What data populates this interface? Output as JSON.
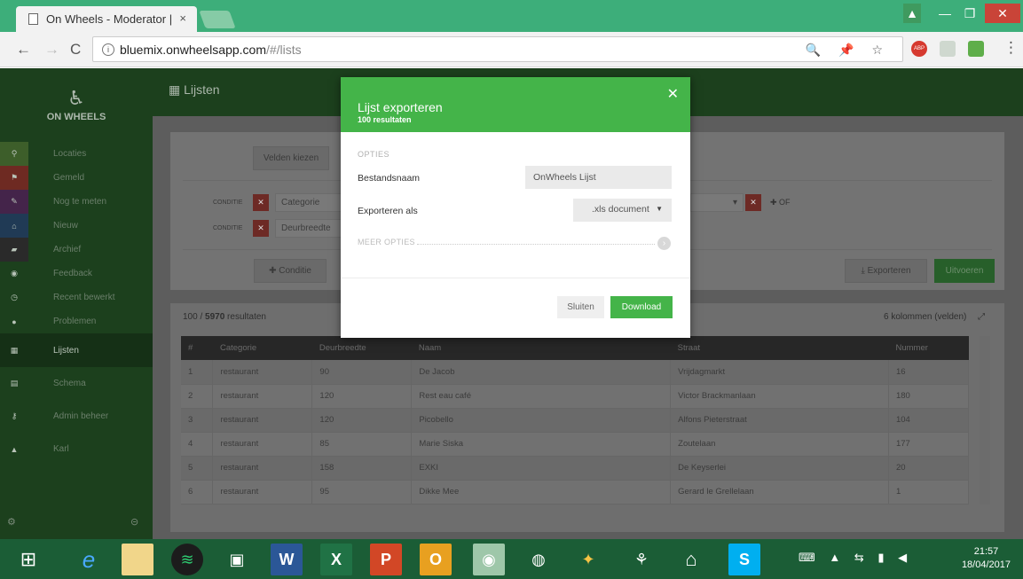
{
  "browser": {
    "tab_title": "On Wheels - Moderator |",
    "tab_close": "×",
    "url_host": "bluemix.onwheelsapp.com",
    "url_path": "/#/lists",
    "info_icon": "i",
    "nav_back": "←",
    "nav_forward": "→",
    "nav_reload": "C",
    "omni_icons": "🔍 📌 ☆",
    "ext_abp": "ABP"
  },
  "app": {
    "logo_mark": "♿",
    "logo_name": "ON WHEELS",
    "page_title": "Lijsten",
    "page_icon": "▦"
  },
  "sidebar": {
    "items": [
      {
        "label": "Locaties",
        "icon": "pin-icon",
        "glyph": "⚲",
        "color": "#3d5e2a"
      },
      {
        "label": "Gemeld",
        "icon": "flag-icon",
        "glyph": "⚑",
        "color": "#6e2a22"
      },
      {
        "label": "Nog te meten",
        "icon": "pencil-icon",
        "glyph": "✎",
        "color": "#44244a"
      },
      {
        "label": "Nieuw",
        "icon": "inbox-icon",
        "glyph": "⌂",
        "color": "#203a55"
      },
      {
        "label": "Archief",
        "icon": "folder-icon",
        "glyph": "▰",
        "color": "#2a2a2a"
      },
      {
        "label": "Feedback",
        "icon": "eye-icon",
        "glyph": "◉",
        "color": ""
      },
      {
        "label": "Recent bewerkt",
        "icon": "clock-icon",
        "glyph": "◷",
        "color": ""
      },
      {
        "label": "Problemen",
        "icon": "alert-icon",
        "glyph": "●",
        "color": ""
      },
      {
        "label": "Lijsten",
        "icon": "table-icon",
        "glyph": "▦",
        "color": ""
      },
      {
        "label": "Schema",
        "icon": "database-icon",
        "glyph": "▤",
        "color": ""
      },
      {
        "label": "Admin beheer",
        "icon": "key-icon",
        "glyph": "⚷",
        "color": ""
      },
      {
        "label": "Karl",
        "icon": "user-icon",
        "glyph": "▲",
        "color": ""
      }
    ],
    "footer_left": "⚙",
    "footer_right": "⊝"
  },
  "filters": {
    "fields_button": "Velden kiezen",
    "condition_label": "CONDITIE",
    "conditions": [
      {
        "field": "Categorie"
      },
      {
        "field": "Deurbreedte"
      }
    ],
    "or_label": "✚ OF",
    "add_condition": "✚  Conditie",
    "export_button": "⤓  Exporteren",
    "run_button": "Uitvoeren"
  },
  "results": {
    "count_prefix": "100 / ",
    "count_total": "5970",
    "count_suffix": " resultaten",
    "columns_label": "6 kolommen (velden)",
    "expand_icon": "⤢",
    "headers": [
      "#",
      "Categorie",
      "Deurbreedte",
      "Naam",
      "Straat",
      "Nummer"
    ],
    "rows": [
      [
        "1",
        "restaurant",
        "90",
        "De Jacob",
        "Vrijdagmarkt",
        "16"
      ],
      [
        "2",
        "restaurant",
        "120",
        "Rest eau café",
        "Victor Brackmanlaan",
        "180"
      ],
      [
        "3",
        "restaurant",
        "120",
        "Picobello",
        "Alfons Pieterstraat",
        "104"
      ],
      [
        "4",
        "restaurant",
        "85",
        "Marie Siska",
        "Zoutelaan",
        "177"
      ],
      [
        "5",
        "restaurant",
        "158",
        "EXKI",
        "De Keyserlei",
        "20"
      ],
      [
        "6",
        "restaurant",
        "95",
        "Dikke Mee",
        "Gerard le Grellelaan",
        "1"
      ]
    ]
  },
  "modal": {
    "title": "Lijst exporteren",
    "subtitle": "100 resultaten",
    "close": "✕",
    "section": "OPTIES",
    "filename_label": "Bestandsnaam",
    "filename_value": "OnWheels Lijst",
    "export_as_label": "Exporteren als",
    "export_as_value": ".xls document",
    "caret": "▼",
    "more_options": "MEER OPTIES",
    "more_icon": "›",
    "close_button": "Sluiten",
    "download_button": "Download"
  },
  "taskbar": {
    "time": "21:57",
    "date": "18/04/2017",
    "tray": "⌨ ▲ ⇆ ▮ ◀"
  },
  "colors": {
    "brand_green": "#44b449",
    "chrome_green": "#3dae7a",
    "danger_red": "#c94438"
  }
}
